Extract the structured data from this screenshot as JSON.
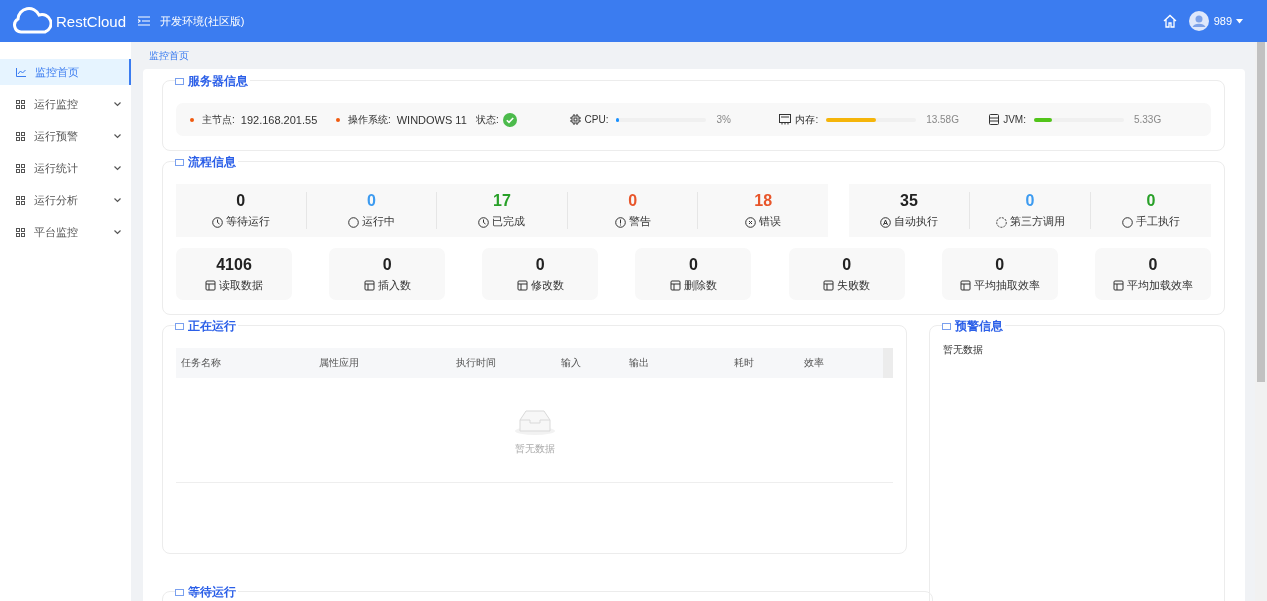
{
  "header": {
    "logo": "RestCloud",
    "env": "开发环境(社区版)",
    "user": "989"
  },
  "sidebar": {
    "items": [
      {
        "label": "监控首页",
        "selected": true,
        "expandable": false
      },
      {
        "label": "运行监控",
        "selected": false,
        "expandable": true
      },
      {
        "label": "运行预警",
        "selected": false,
        "expandable": true
      },
      {
        "label": "运行统计",
        "selected": false,
        "expandable": true
      },
      {
        "label": "运行分析",
        "selected": false,
        "expandable": true
      },
      {
        "label": "平台监控",
        "selected": false,
        "expandable": true
      }
    ]
  },
  "breadcrumb": "监控首页",
  "server_info": {
    "title": "服务器信息",
    "items": [
      {
        "kind": "text",
        "label": "主节点:",
        "value": "192.168.201.55"
      },
      {
        "kind": "text",
        "label": "操作系统:",
        "value": "WINDOWS 11"
      },
      {
        "kind": "status",
        "label": "状态:",
        "ok": true
      },
      {
        "kind": "meter",
        "label": "CPU:",
        "level": 0.03,
        "color": "#1890ff",
        "reading": "3%"
      },
      {
        "kind": "meter",
        "label": "内存:",
        "level": 0.55,
        "color": "#f5b50a",
        "reading": "13.58G"
      },
      {
        "kind": "meter",
        "label": "JVM:",
        "level": 0.2,
        "color": "#52c41a",
        "reading": "5.33G"
      }
    ]
  },
  "flow_info": {
    "title": "流程信息",
    "status_groups": [
      [
        {
          "value": "0",
          "label": "等待运行",
          "color": "#222222"
        },
        {
          "value": "0",
          "label": "运行中",
          "color": "#3d9bf0"
        },
        {
          "value": "17",
          "label": "已完成",
          "color": "#28a028"
        },
        {
          "value": "0",
          "label": "警告",
          "color": "#e8552a"
        },
        {
          "value": "18",
          "label": "错误",
          "color": "#e8552a"
        }
      ],
      [
        {
          "value": "35",
          "label": "自动执行",
          "color": "#222222"
        },
        {
          "value": "0",
          "label": "第三方调用",
          "color": "#3d9bf0"
        },
        {
          "value": "0",
          "label": "手工执行",
          "color": "#28a028"
        }
      ]
    ],
    "counters": [
      {
        "value": "4106",
        "label": "读取数据"
      },
      {
        "value": "0",
        "label": "插入数"
      },
      {
        "value": "0",
        "label": "修改数"
      },
      {
        "value": "0",
        "label": "删除数"
      },
      {
        "value": "0",
        "label": "失败数"
      },
      {
        "value": "0",
        "label": "平均抽取效率"
      },
      {
        "value": "0",
        "label": "平均加载效率"
      }
    ]
  },
  "running": {
    "title": "正在运行",
    "columns": [
      "任务名称",
      "属性应用",
      "执行时间",
      "输入",
      "输出",
      "耗时",
      "效率"
    ],
    "empty_text": "暂无数据"
  },
  "warnings": {
    "title": "预警信息",
    "empty_text": "暂无数据"
  },
  "waiting": {
    "title": "等待运行"
  }
}
